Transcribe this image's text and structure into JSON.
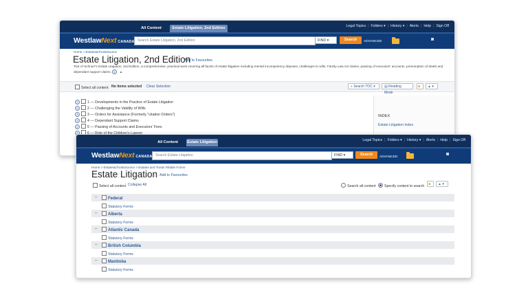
{
  "window_a": {
    "tabs": [
      "All Content",
      "Estate Litigation, 2nd Edition"
    ],
    "toplinks": [
      "Legal Topics",
      "Folders ▾",
      "History ▾",
      "Alerts",
      "Help",
      "Sign Off"
    ],
    "logo": {
      "westlaw": "Westlaw",
      "next": "Next",
      "canada": "CANADA"
    },
    "search_placeholder": "Search Estate Litigation, 2nd Edition",
    "find_label": "FIND",
    "search_button": "Search",
    "advanced": "ADVANCED",
    "breadcrumb": "Home > Estates&TrustsSource",
    "title": "Estate Litigation, 2nd Edition",
    "add_favourites": "Add to Favourites",
    "description_line1": "Text of Schnurr's Estate Litigation, 2nd Edition, a comprehensive, practical work covering all facets of estate litigation including mental incompetency disputes, challenges to wills, Family Law Act claims, passing of executors' accounts, presumption of death and",
    "description_line2": "dependant support claims.",
    "toolbar": {
      "select_all": "Select all content",
      "no_items": "No items selected",
      "clear": "Clear Selection",
      "search_toc": "Search TOC ▾",
      "reading_mode": "Reading Mode"
    },
    "toc": [
      "1 — Developments in the Practice of Estate Litigation",
      "2 — Challenging the Validity of Wills",
      "3 — Orders for Assistance (Formerly \"citation Orders\")",
      "4 — Dependant Support Claims",
      "5 — Passing of Accounts and Executors' Fees",
      "6 — Role of the Children's Lawyer"
    ],
    "index_label": "INDEX",
    "index_link": "Estate Litigation Index"
  },
  "window_b": {
    "tabs": [
      "All Content",
      "Estate Litigation"
    ],
    "toplinks": [
      "Legal Topics",
      "Folders ▾",
      "History ▾",
      "Alerts",
      "Help",
      "Sign Off"
    ],
    "logo": {
      "westlaw": "Westlaw",
      "next": "Next",
      "canada": "CANADA"
    },
    "search_placeholder": "Search Estate Litigation",
    "find_label": "FIND",
    "search_button": "Search",
    "advanced": "ADVANCED",
    "breadcrumb": "Home > Estates&TrustsSource > Estates and Trusts Fillable Forms",
    "title": "Estate Litigation",
    "add_favourites": "Add to Favourites",
    "toolbar": {
      "select_all": "Select all content",
      "collapse_all": "Collapse All",
      "search_all": "Search all content",
      "specify": "Specify content to search"
    },
    "regions": [
      {
        "name": "Federal",
        "child": "Statutory Forms"
      },
      {
        "name": "Alberta",
        "child": "Statutory Forms"
      },
      {
        "name": "Atlantic Canada",
        "child": "Statutory Forms"
      },
      {
        "name": "British Columbia",
        "child": "Statutory Forms"
      },
      {
        "name": "Manitoba",
        "child": "Statutory Forms"
      }
    ]
  }
}
